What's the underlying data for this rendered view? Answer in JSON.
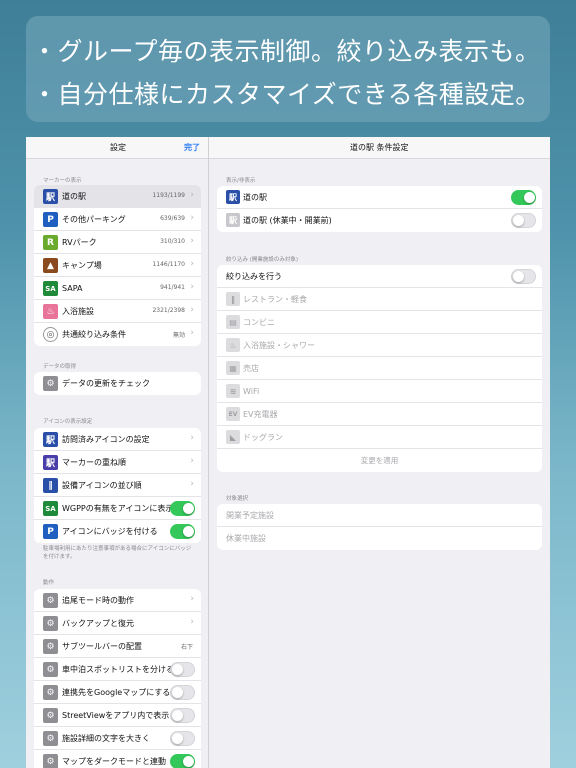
{
  "banner": {
    "line1": "・グループ毎の表示制御。絞り込み表示も。",
    "line2": "・自分仕様にカスタマイズできる各種設定。"
  },
  "nav": {
    "left_title": "設定",
    "done": "完了",
    "right_title": "道の駅 条件設定"
  },
  "left": {
    "marker_header": "マーカーの表示",
    "markers": [
      {
        "label": "道の駅",
        "value": "1193/1199",
        "icon": "michi-no-eki-icon",
        "color": "#2a4fa8",
        "glyph": "駅",
        "selected": true
      },
      {
        "label": "その他パーキング",
        "value": "639/639",
        "icon": "parking-icon",
        "color": "#1f5fbf",
        "glyph": "P"
      },
      {
        "label": "RVパーク",
        "value": "310/310",
        "icon": "rv-park-icon",
        "color": "#6aab2e",
        "glyph": "R"
      },
      {
        "label": "キャンプ場",
        "value": "1146/1170",
        "icon": "campground-icon",
        "color": "#8a4a1e",
        "glyph": "▲"
      },
      {
        "label": "SAPA",
        "value": "941/941",
        "icon": "sapa-icon",
        "color": "#1f8a3a",
        "glyph": "SA"
      },
      {
        "label": "入浴施設",
        "value": "2321/2398",
        "icon": "bath-icon",
        "color": "#e8749a",
        "glyph": "♨"
      },
      {
        "label": "共通絞り込み条件",
        "value": "無効",
        "icon": "common-filter-icon",
        "color": "#777777",
        "glyph": "◎"
      }
    ],
    "data_header": "データの取得",
    "data_items": [
      {
        "label": "データの更新をチェック",
        "icon": "gear-icon"
      }
    ],
    "icon_header": "アイコンの表示設定",
    "icon_items": [
      {
        "label": "訪問済みアイコンの設定",
        "icon": "visited-icon",
        "color": "#2a4fa8",
        "glyph": "駅",
        "type": "chevron"
      },
      {
        "label": "マーカーの重ね順",
        "icon": "marker-order-icon",
        "color": "#4a3fa8",
        "glyph": "駅",
        "type": "chevron"
      },
      {
        "label": "設備アイコンの並び順",
        "icon": "facility-order-icon",
        "color": "#2a4fa8",
        "glyph": "||",
        "type": "chevron"
      },
      {
        "label": "WGPPの有無をアイコンに表示",
        "icon": "wgpp-icon",
        "color": "#1f8a3a",
        "glyph": "SA",
        "type": "toggle",
        "on": true
      },
      {
        "label": "アイコンにバッジを付ける",
        "icon": "badge-icon",
        "color": "#1f5fbf",
        "glyph": "P",
        "type": "toggle",
        "on": true
      }
    ],
    "icon_note": "駐車場利用にあたり注意事項がある場合にアイコンにバッジを付けます。",
    "action_header": "動作",
    "action_items": [
      {
        "label": "追尾モード時の動作",
        "type": "chevron"
      },
      {
        "label": "バックアップと復元",
        "type": "chevron"
      },
      {
        "label": "サブツールバーの配置",
        "type": "value",
        "value": "右下"
      },
      {
        "label": "車中泊スポットリストを分ける",
        "type": "toggle",
        "on": false
      },
      {
        "label": "連携先をGoogleマップにする",
        "type": "toggle",
        "on": false
      },
      {
        "label": "StreetViewをアプリ内で表示",
        "type": "toggle",
        "on": false
      },
      {
        "label": "施設詳細の文字を大きく",
        "type": "toggle",
        "on": false
      },
      {
        "label": "マップをダークモードと連動",
        "type": "toggle",
        "on": true
      }
    ]
  },
  "right": {
    "display_header": "表示/非表示",
    "display_items": [
      {
        "label": "道の駅",
        "on": true,
        "icon": "michi-no-eki-icon",
        "color": "#2a4fa8"
      },
      {
        "label": "道の駅 (休業中・開業前)",
        "on": false,
        "icon": "michi-no-eki-closed-icon",
        "color": "#c8c8cc"
      }
    ],
    "filter_header": "絞り込み (開業施設のみ対象)",
    "filter_toggle_label": "絞り込みを行う",
    "filter_items": [
      {
        "label": "レストラン・軽食",
        "icon": "restaurant-icon",
        "glyph": "||"
      },
      {
        "label": "コンビニ",
        "icon": "convenience-store-icon",
        "glyph": "▤"
      },
      {
        "label": "入浴施設・シャワー",
        "icon": "bath-shower-icon",
        "glyph": "♨"
      },
      {
        "label": "売店",
        "icon": "shop-icon",
        "glyph": "▦"
      },
      {
        "label": "WiFi",
        "icon": "wifi-icon",
        "glyph": "≋"
      },
      {
        "label": "EV充電器",
        "icon": "ev-charger-icon",
        "glyph": "EV"
      },
      {
        "label": "ドッグラン",
        "icon": "dog-run-icon",
        "glyph": "◣"
      }
    ],
    "apply_label": "変更を適用",
    "target_header": "対象選択",
    "target_items": [
      {
        "label": "開業予定施設"
      },
      {
        "label": "休業中施設"
      }
    ]
  }
}
